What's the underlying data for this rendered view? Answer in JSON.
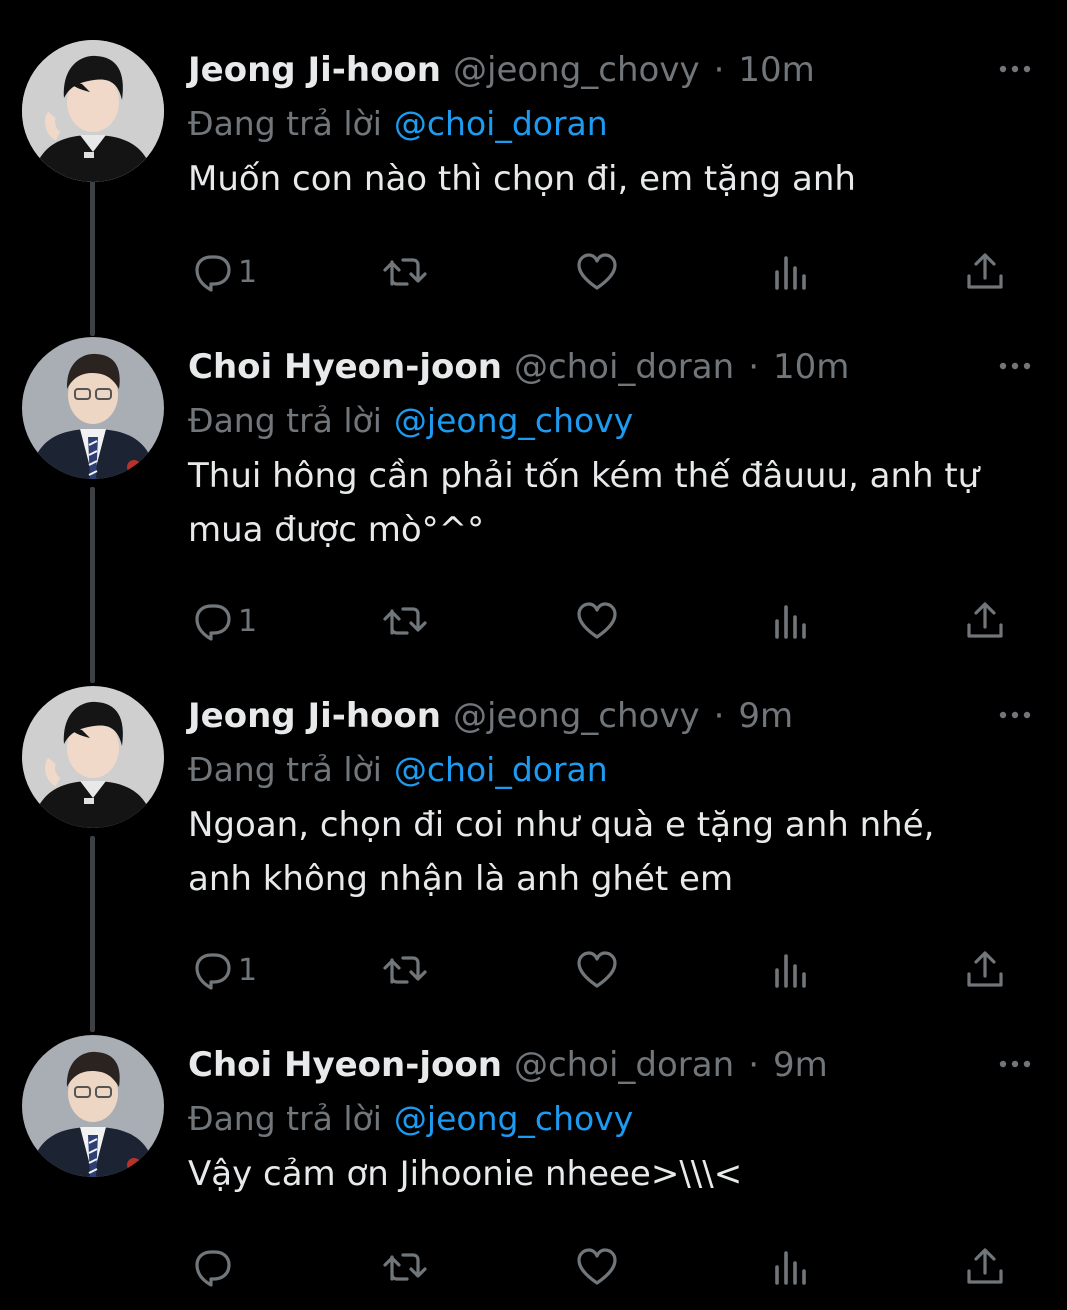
{
  "reply_prefix": "Đang trả lời",
  "dot": "·",
  "colors": {
    "background": "#000000",
    "text": "#e7e9ea",
    "muted": "#71767b",
    "link": "#1d9bf0",
    "thread_line": "#3e4144"
  },
  "tweets": [
    {
      "name": "Jeong Ji-hoon",
      "handle": "@jeong_chovy",
      "time": "10m",
      "reply_to": "@choi_doran",
      "text_lines": [
        "Muốn con nào thì chọn đi, em tặng anh"
      ],
      "reply_count": "1",
      "avatar": "jeong-avatar"
    },
    {
      "name": "Choi Hyeon-joon",
      "handle": "@choi_doran",
      "time": "10m",
      "reply_to": "@jeong_chovy",
      "text_lines": [
        "Thui hông cần phải tốn kém thế đâuuu, anh tự",
        "mua được mò°^°"
      ],
      "reply_count": "1",
      "avatar": "choi-avatar"
    },
    {
      "name": "Jeong Ji-hoon",
      "handle": "@jeong_chovy",
      "time": "9m",
      "reply_to": "@choi_doran",
      "text_lines": [
        "Ngoan, chọn đi coi như quà e tặng anh nhé,",
        "anh không nhận là anh ghét em"
      ],
      "reply_count": "1",
      "avatar": "jeong-avatar"
    },
    {
      "name": "Choi Hyeon-joon",
      "handle": "@choi_doran",
      "time": "9m",
      "reply_to": "@jeong_chovy",
      "text_lines": [
        "Vậy cảm ơn Jihoonie nheee>\\\\\\<"
      ],
      "reply_count": "",
      "avatar": "choi-avatar"
    }
  ],
  "icons": [
    "reply-icon",
    "retweet-icon",
    "like-icon",
    "views-icon",
    "share-icon",
    "more-icon"
  ]
}
